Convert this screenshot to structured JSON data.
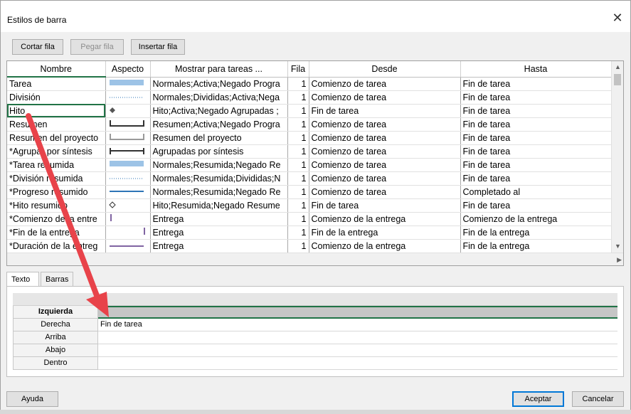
{
  "window": {
    "title": "Estilos de barra",
    "close_glyph": "✕"
  },
  "toolbar": {
    "cut_label": "Cortar fila",
    "paste_label": "Pegar fila",
    "insert_label": "Insertar fila"
  },
  "grid": {
    "columns": [
      "Nombre",
      "Aspecto",
      "Mostrar para tareas ...",
      "Fila",
      "Desde",
      "Hasta"
    ],
    "rows": [
      {
        "name": "Tarea",
        "aspect": "bar-blue",
        "show": "Normales;Activa;Negado Progra",
        "row": "1",
        "from": "Comienzo de tarea",
        "to": "Fin de tarea"
      },
      {
        "name": "División",
        "aspect": "dotted-line",
        "show": "Normales;Divididas;Activa;Nega",
        "row": "1",
        "from": "Comienzo de tarea",
        "to": "Fin de tarea"
      },
      {
        "name": "Hito",
        "aspect": "diamond-filled",
        "show": "Hito;Activa;Negado Agrupadas ;",
        "row": "1",
        "from": "Fin de tarea",
        "to": "Fin de tarea"
      },
      {
        "name": "Resumen",
        "aspect": "summary-bracket",
        "show": "Resumen;Activa;Negado Progra",
        "row": "1",
        "from": "Comienzo de tarea",
        "to": "Fin de tarea"
      },
      {
        "name": "Resumen del proyecto",
        "aspect": "project-summary",
        "show": "Resumen del proyecto",
        "row": "1",
        "from": "Comienzo de tarea",
        "to": "Fin de tarea"
      },
      {
        "name": "*Agrupar por síntesis",
        "aspect": "group-bar",
        "show": "Agrupadas por síntesis",
        "row": "1",
        "from": "Comienzo de tarea",
        "to": "Fin de tarea"
      },
      {
        "name": "*Tarea resumida",
        "aspect": "bar-blue",
        "show": "Normales;Resumida;Negado Re",
        "row": "1",
        "from": "Comienzo de tarea",
        "to": "Fin de tarea"
      },
      {
        "name": "*División resumida",
        "aspect": "dotted-line",
        "show": "Normales;Resumida;Divididas;N",
        "row": "1",
        "from": "Comienzo de tarea",
        "to": "Fin de tarea"
      },
      {
        "name": "*Progreso resumido",
        "aspect": "progress-line",
        "show": "Normales;Resumida;Negado Re",
        "row": "1",
        "from": "Comienzo de tarea",
        "to": "Completado al"
      },
      {
        "name": "*Hito resumido",
        "aspect": "diamond-hollow",
        "show": "Hito;Resumida;Negado Resume",
        "row": "1",
        "from": "Fin de tarea",
        "to": "Fin de tarea"
      },
      {
        "name": "*Comienzo de la entre",
        "aspect": "deliverable-start",
        "show": "Entrega",
        "row": "1",
        "from": "Comienzo de la entrega",
        "to": "Comienzo de la entrega"
      },
      {
        "name": "*Fin de la entrega",
        "aspect": "deliverable-end",
        "show": "Entrega",
        "row": "1",
        "from": "Fin de la entrega",
        "to": "Fin de la entrega"
      },
      {
        "name": "*Duración de la entreg",
        "aspect": "deliverable-duration",
        "show": "Entrega",
        "row": "1",
        "from": "Comienzo de la entrega",
        "to": "Fin de la entrega"
      }
    ]
  },
  "tabs": [
    {
      "label": "Texto",
      "active": true
    },
    {
      "label": "Barras",
      "active": false
    }
  ],
  "text_props": [
    {
      "label": "Izquierda",
      "value": "",
      "active": true
    },
    {
      "label": "Derecha",
      "value": "Fin de tarea",
      "active": false
    },
    {
      "label": "Arriba",
      "value": "",
      "active": false
    },
    {
      "label": "Abajo",
      "value": "",
      "active": false
    },
    {
      "label": "Dentro",
      "value": "",
      "active": false
    }
  ],
  "footer": {
    "help_label": "Ayuda",
    "ok_label": "Aceptar",
    "cancel_label": "Cancelar"
  },
  "colors": {
    "accent_green": "#217346",
    "bar_blue": "#9dc3e6",
    "arrow_red": "#e8434a",
    "progress_blue": "#2e75b6",
    "deliverable_purple": "#8064a2"
  }
}
